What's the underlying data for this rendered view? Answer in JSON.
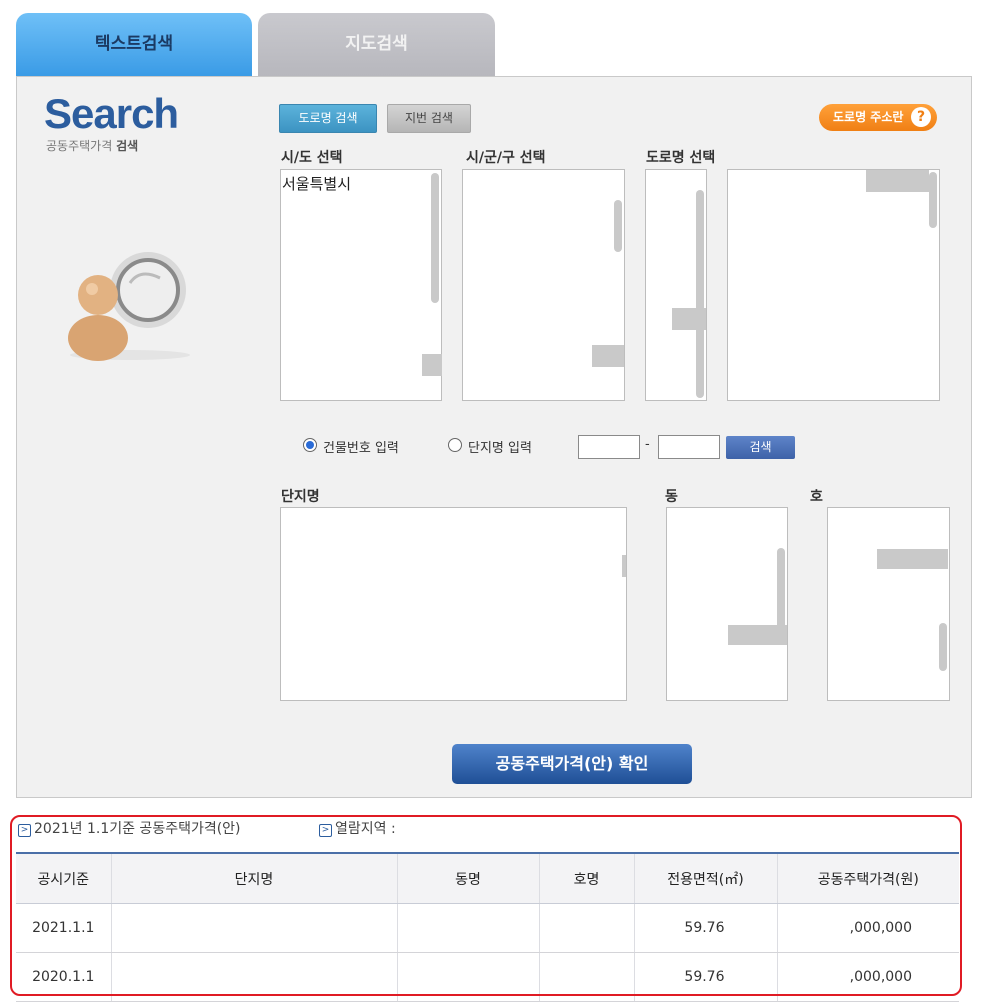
{
  "tabs": [
    {
      "label": "텍스트검색",
      "active": true
    },
    {
      "label": "지도검색",
      "active": false
    }
  ],
  "logo": {
    "title": "Search",
    "subtitle_plain": "공동주택가격",
    "subtitle_bold": "검색"
  },
  "search_mode": {
    "road_button": "도로명 검색",
    "lot_button": "지번 검색",
    "guide_button": "도로명 주소란",
    "guide_icon": "?"
  },
  "selectors": {
    "sido_label": "시/도 선택",
    "sido_items": [
      "서울특별시"
    ],
    "sigungu_label": "시/군/구 선택",
    "road_label": "도로명 선택"
  },
  "input_mode": {
    "option_building": "건물번호 입력",
    "option_complex": "단지명 입력",
    "dash": "-",
    "search_button": "검색"
  },
  "lists": {
    "complex_label": "단지명",
    "dong_label": "동",
    "ho_label": "호"
  },
  "confirm_button": "공동주택가격(안) 확인",
  "info": {
    "bullet": ">",
    "base_text": "2021년 1.1기준 공동주택가격(안)",
    "area_text": "열람지역 :"
  },
  "table": {
    "headers": [
      "공시기준",
      "단지명",
      "동명",
      "호명",
      "전용면적(㎡)",
      "공동주택가격(원)"
    ],
    "rows": [
      [
        "2021.1.1",
        "",
        "",
        "",
        "59.76",
        ",000,000"
      ],
      [
        "2020.1.1",
        "",
        "",
        "",
        "59.76",
        ",000,000"
      ]
    ]
  },
  "colors": {
    "accent": "#3a9be6",
    "confirm": "#1f4f96",
    "highlight": "#e01b24",
    "guide": "#f07f14"
  }
}
